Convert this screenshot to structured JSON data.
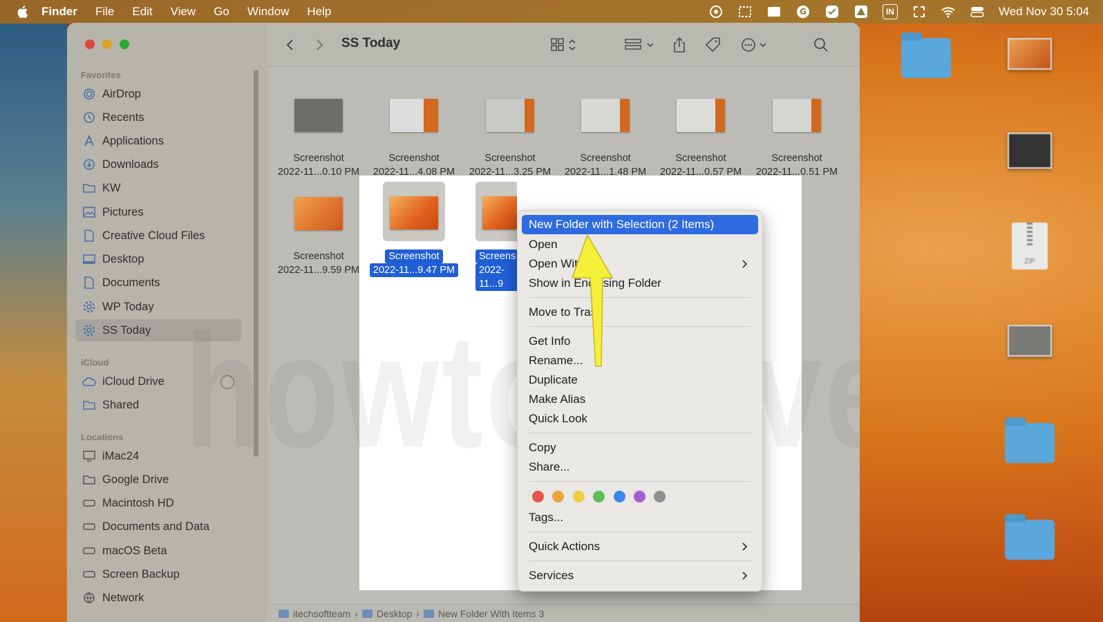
{
  "menubar": {
    "app_name": "Finder",
    "items": [
      "File",
      "Edit",
      "View",
      "Go",
      "Window",
      "Help"
    ],
    "input_source": "IN",
    "clock": "Wed Nov 30  5:04"
  },
  "window": {
    "title": "SS Today"
  },
  "sidebar": {
    "favorites_title": "Favorites",
    "favorites": [
      "AirDrop",
      "Recents",
      "Applications",
      "Downloads",
      "KW",
      "Pictures",
      "Creative Cloud Files",
      "Desktop",
      "Documents",
      "WP Today",
      "SS Today"
    ],
    "icloud_title": "iCloud",
    "icloud": [
      "iCloud Drive",
      "Shared"
    ],
    "locations_title": "Locations",
    "locations": [
      "iMac24",
      "Google Drive",
      "Macintosh HD",
      "Documents and Data",
      "macOS Beta",
      "Screen Backup",
      "Network"
    ]
  },
  "files": [
    {
      "name": "Screenshot",
      "date": "2022-11...0.10 PM"
    },
    {
      "name": "Screenshot",
      "date": "2022-11...4.08 PM"
    },
    {
      "name": "Screenshot",
      "date": "2022-11...3.25 PM"
    },
    {
      "name": "Screenshot",
      "date": "2022-11...1.48 PM"
    },
    {
      "name": "Screenshot",
      "date": "2022-11...0.57 PM"
    },
    {
      "name": "Screenshot",
      "date": "2022-11...0.51 PM"
    },
    {
      "name": "Screenshot",
      "date": "2022-11...9.59 PM"
    },
    {
      "name": "Screenshot",
      "date": "2022-11...9.47 PM"
    },
    {
      "name": "Screens",
      "date": "2022-11...9"
    }
  ],
  "context_menu": {
    "new_folder": "New Folder with Selection (2 Items)",
    "open": "Open",
    "open_with": "Open With",
    "show_enclosing": "Show in Enclosing Folder",
    "move_to_trash": "Move to Trash",
    "get_info": "Get Info",
    "rename": "Rename...",
    "duplicate": "Duplicate",
    "make_alias": "Make Alias",
    "quick_look": "Quick Look",
    "copy": "Copy",
    "share": "Share...",
    "tags_label": "Tags...",
    "tag_colors": [
      "#e5534b",
      "#eaa33a",
      "#edcd41",
      "#5cc05a",
      "#3d86e6",
      "#a45fd6",
      "#8e8e8e"
    ],
    "quick_actions": "Quick Actions",
    "services": "Services"
  },
  "pathbar": [
    "itechsoftteam",
    "Desktop",
    "New Folder With Items 3"
  ],
  "desktop": {
    "zip_badge": "ZIP"
  },
  "watermark": "howtosolve.c"
}
